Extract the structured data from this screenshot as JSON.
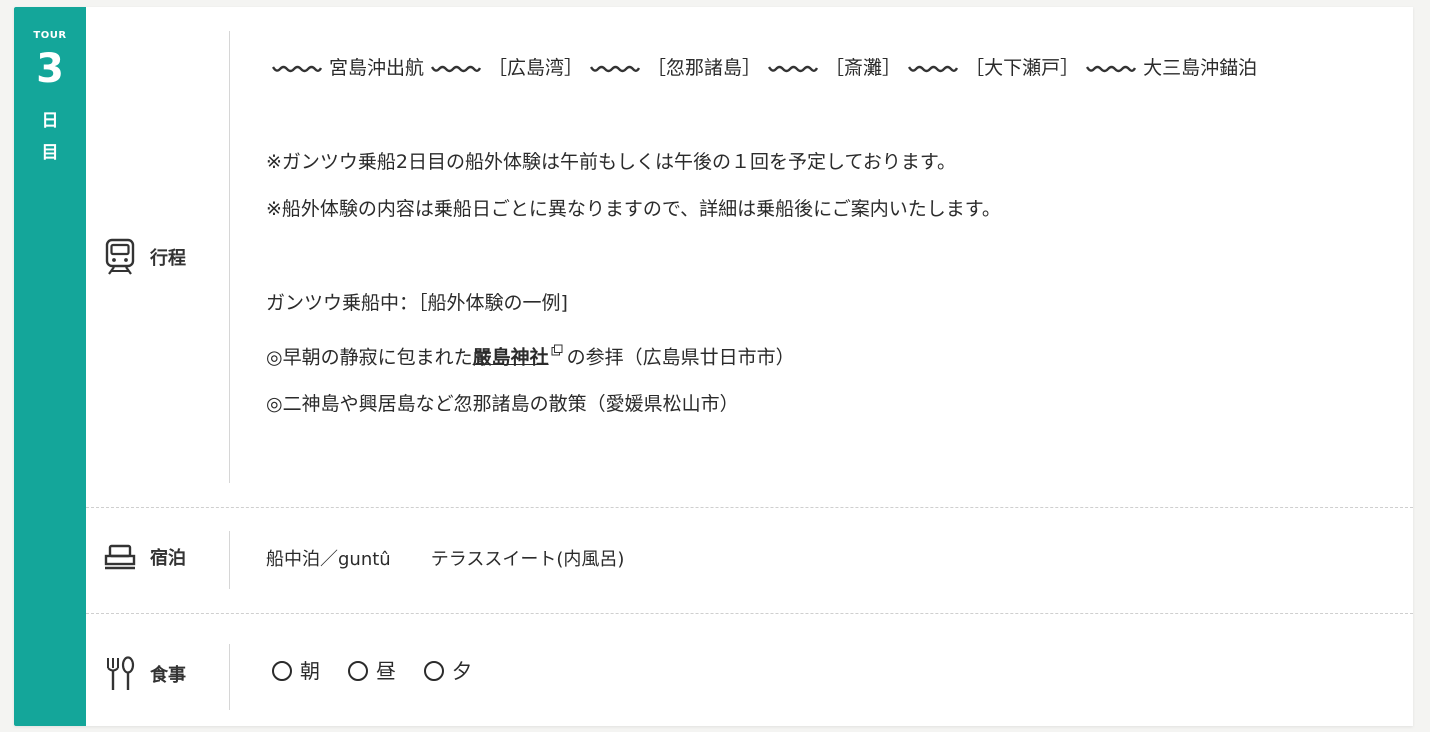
{
  "day": {
    "tour_label": "TOUR",
    "number": "3",
    "kanji_1": "日",
    "kanji_2": "目"
  },
  "itinerary": {
    "label": "行程",
    "route": {
      "start": "宮島沖出航",
      "stops": [
        "［広島湾］",
        "［忽那諸島］",
        "［斎灘］",
        "［大下瀬戸］"
      ],
      "end": "大三島沖錨泊"
    },
    "notes": [
      "※ガンツウ乗船2日目の船外体験は午前もしくは午後の１回を予定しております。",
      "※船外体験の内容は乗船日ごとに異なりますので、詳細は乗船後にご案内いたします。"
    ],
    "examples_heading": "ガンツウ乗船中：［船外体験の一例]",
    "example_1_prefix": "◎早朝の静寂に包まれた",
    "example_1_link": "嚴島神社",
    "example_1_suffix": "の参拝（広島県廿日市市）",
    "example_2": "◎二神島や興居島など忽那諸島の散策（愛媛県松山市）"
  },
  "lodging": {
    "label": "宿泊",
    "place": "船中泊／guntû",
    "room": "テラススイート(内風呂)"
  },
  "meals": {
    "label": "食事",
    "items": [
      "朝",
      "昼",
      "夕"
    ]
  },
  "colors": {
    "accent": "#14a69a"
  }
}
